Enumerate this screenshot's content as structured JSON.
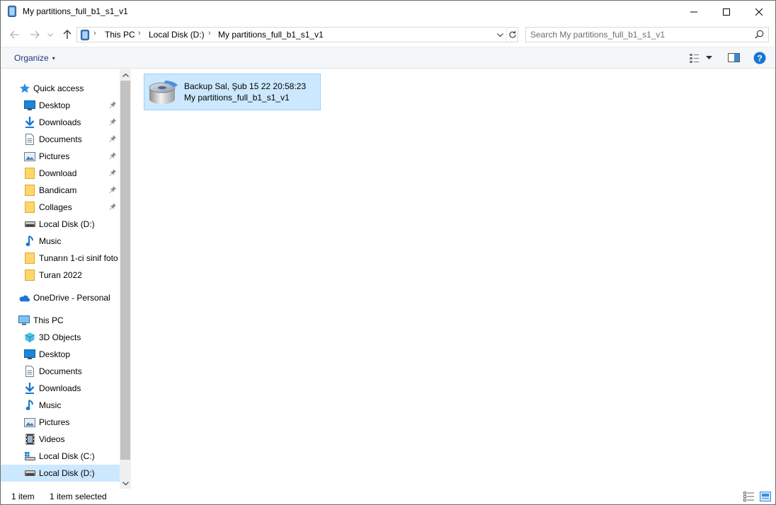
{
  "window": {
    "title": "My partitions_full_b1_s1_v1"
  },
  "address": {
    "crumbs": [
      "This PC",
      "Local Disk (D:)",
      "My partitions_full_b1_s1_v1"
    ],
    "separator": "›"
  },
  "search": {
    "placeholder": "Search My partitions_full_b1_s1_v1"
  },
  "toolbar": {
    "organize_label": "Organize",
    "organize_caret": "▾"
  },
  "nav": {
    "quick_access": {
      "label": "Quick access",
      "items": [
        {
          "label": "Desktop",
          "icon": "desktop-icon",
          "pinned": true
        },
        {
          "label": "Downloads",
          "icon": "download-arrow-icon",
          "pinned": true
        },
        {
          "label": "Documents",
          "icon": "document-icon",
          "pinned": true
        },
        {
          "label": "Pictures",
          "icon": "pictures-icon",
          "pinned": true
        },
        {
          "label": "Download",
          "icon": "folder-icon",
          "pinned": true
        },
        {
          "label": "Bandicam",
          "icon": "folder-icon",
          "pinned": true
        },
        {
          "label": "Collages",
          "icon": "folder-icon",
          "pinned": true
        },
        {
          "label": "Local Disk (D:)",
          "icon": "drive-icon",
          "pinned": false
        },
        {
          "label": "Music",
          "icon": "music-icon",
          "pinned": false
        },
        {
          "label": "Tunarın 1-ci sinif foto",
          "icon": "folder-icon",
          "pinned": false
        },
        {
          "label": "Turan 2022",
          "icon": "folder-icon",
          "pinned": false
        }
      ]
    },
    "onedrive": {
      "label": "OneDrive - Personal"
    },
    "this_pc": {
      "label": "This PC",
      "items": [
        {
          "label": "3D Objects",
          "icon": "3d-objects-icon"
        },
        {
          "label": "Desktop",
          "icon": "desktop-icon"
        },
        {
          "label": "Documents",
          "icon": "document-icon"
        },
        {
          "label": "Downloads",
          "icon": "download-arrow-icon"
        },
        {
          "label": "Music",
          "icon": "music-icon"
        },
        {
          "label": "Pictures",
          "icon": "pictures-icon"
        },
        {
          "label": "Videos",
          "icon": "videos-icon"
        },
        {
          "label": "Local Disk (C:)",
          "icon": "windows-drive-icon"
        },
        {
          "label": "Local Disk (D:)",
          "icon": "drive-icon",
          "selected": true
        }
      ]
    }
  },
  "files": [
    {
      "name": "Backup Sal, Şub 15 22 20:58:23 My partitions_full_b1_s1_v1",
      "icon": "backup-disk-icon",
      "selected": true
    }
  ],
  "status": {
    "count": "1 item",
    "selected": "1 item selected"
  },
  "colors": {
    "selection_bg": "#cce8ff",
    "selection_border": "#99d1ff",
    "accent": "#0078d7",
    "folder": "#ffd766"
  }
}
